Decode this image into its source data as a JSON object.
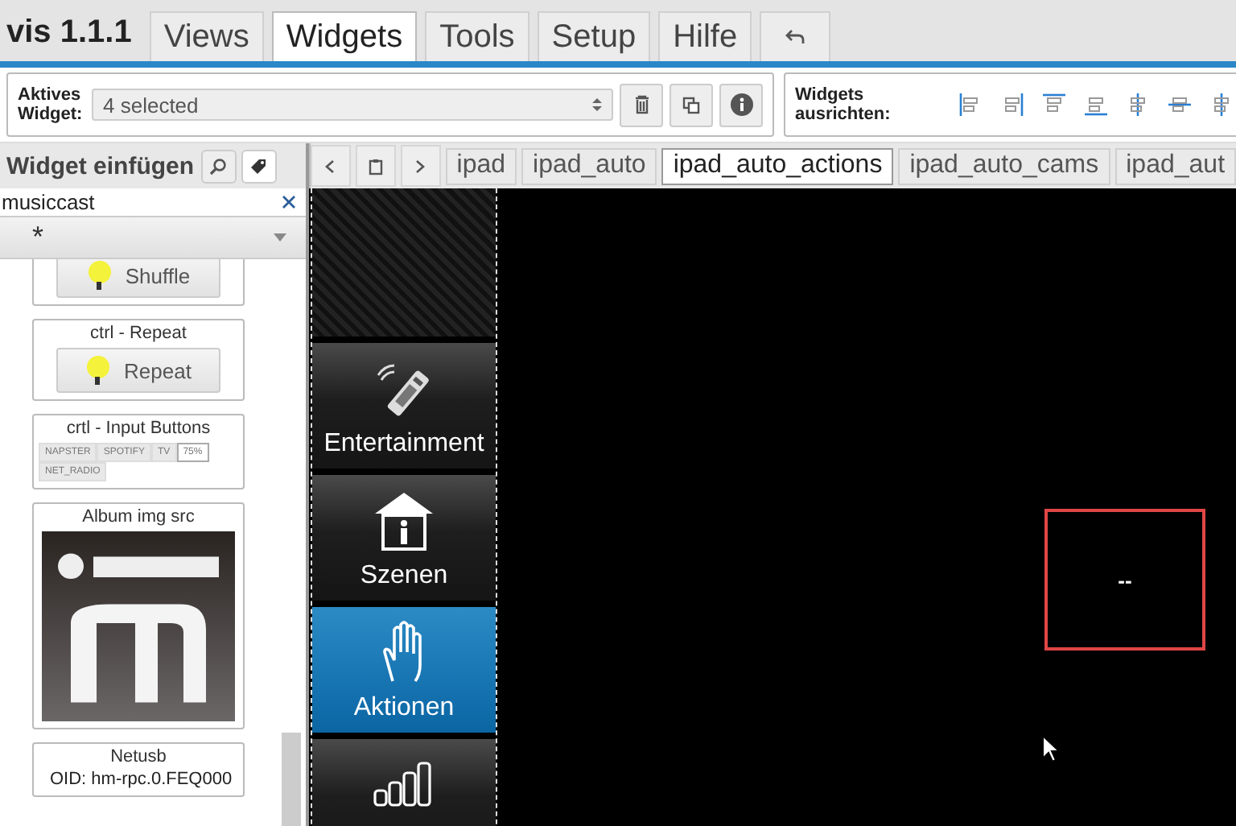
{
  "app": {
    "title": "vis 1.1.1"
  },
  "menu_tabs": [
    {
      "label": "Views",
      "selected": false
    },
    {
      "label": "Widgets",
      "selected": true
    },
    {
      "label": "Tools",
      "selected": false
    },
    {
      "label": "Setup",
      "selected": false
    },
    {
      "label": "Hilfe",
      "selected": false
    }
  ],
  "toolbar": {
    "active_widget_label": "Aktives Widget:",
    "active_widget_value": "4 selected",
    "align_label": "Widgets ausrichten:"
  },
  "palette": {
    "title": "Widget einfügen",
    "filter": "musiccast",
    "set_select": "*",
    "widgets": [
      {
        "kind": "button",
        "label": "Shuffle"
      },
      {
        "kind": "button",
        "title": "ctrl - Repeat",
        "label": "Repeat"
      },
      {
        "kind": "input_buttons",
        "title": "crtl - Input Buttons",
        "buttons": [
          {
            "label": "NAPSTER",
            "selected": false
          },
          {
            "label": "SPOTIFY",
            "selected": false
          },
          {
            "label": "TV",
            "selected": false
          },
          {
            "label": "75%",
            "selected": true
          },
          {
            "label": "NET_RADIO",
            "selected": false
          }
        ]
      },
      {
        "title": "Album img src"
      },
      {
        "kind": "text",
        "title": "Netusb",
        "text": "OID: hm-rpc.0.FEQ000"
      }
    ]
  },
  "view_tabs": [
    {
      "label": "ipad",
      "selected": false
    },
    {
      "label": "ipad_auto",
      "selected": false
    },
    {
      "label": "ipad_auto_actions",
      "selected": true
    },
    {
      "label": "ipad_auto_cams",
      "selected": false
    },
    {
      "label": "ipad_aut",
      "selected": false
    }
  ],
  "canvas": {
    "nav_items": [
      {
        "label": "Entertainment",
        "selected": false
      },
      {
        "label": "Szenen",
        "selected": false
      },
      {
        "label": "Aktionen",
        "selected": true
      },
      {
        "selected": false
      }
    ],
    "value_widget": {
      "text": "--"
    }
  }
}
